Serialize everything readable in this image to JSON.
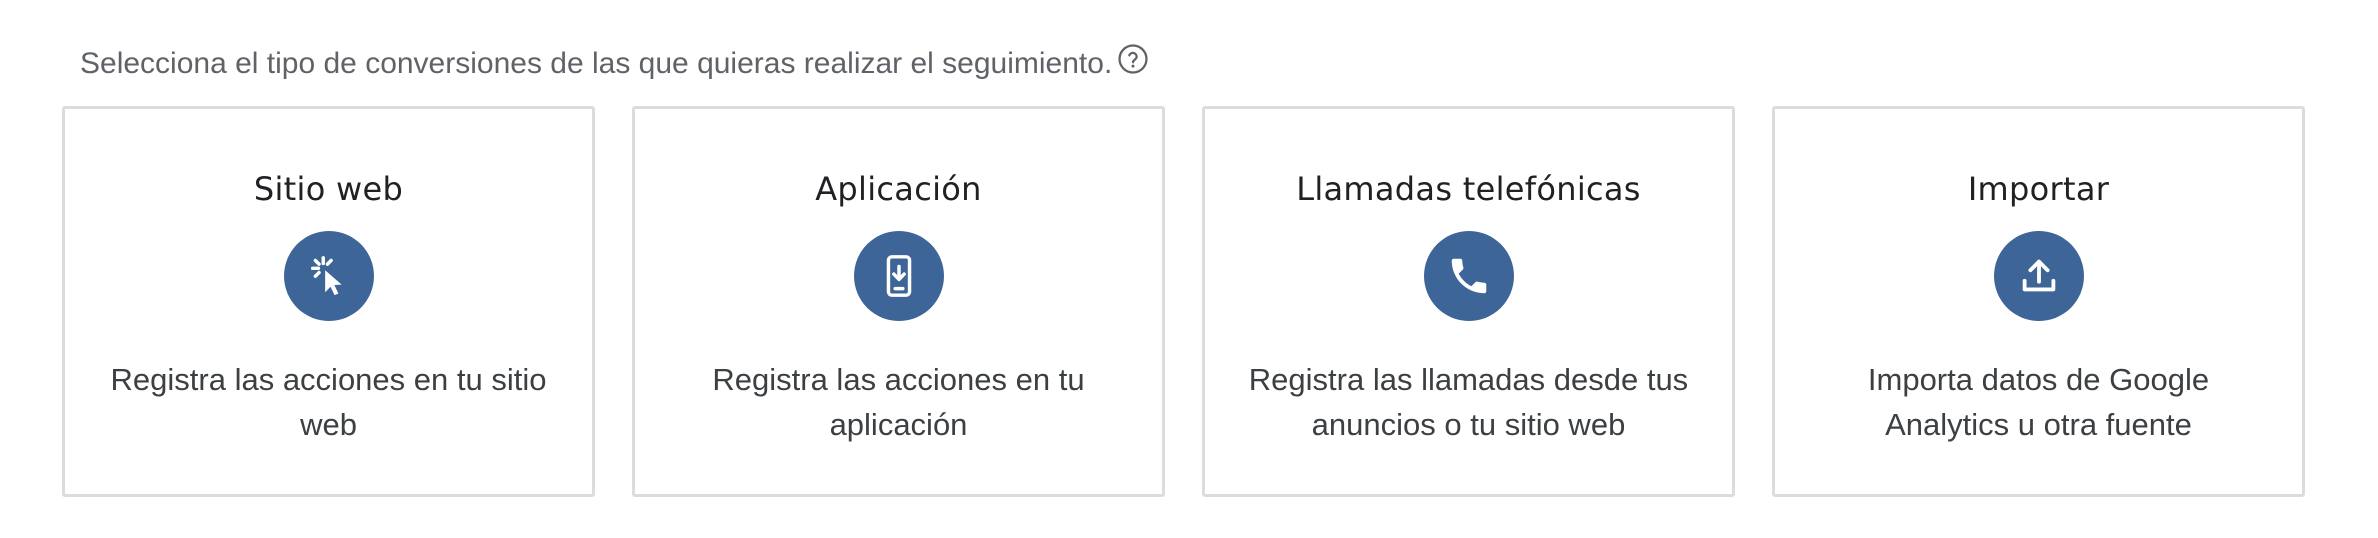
{
  "prompt": {
    "text": "Selecciona el tipo de conversiones de las que quieras realizar el seguimiento.",
    "help_icon": "help-circle-icon"
  },
  "accent_color": "#3e6597",
  "cards": [
    {
      "title": "Sitio web",
      "icon": "cursor-click-icon",
      "description": "Registra las acciones en tu sitio web"
    },
    {
      "title": "Aplicación",
      "icon": "phone-download-icon",
      "description": "Registra las acciones en tu aplicación"
    },
    {
      "title": "Llamadas telefónicas",
      "icon": "phone-call-icon",
      "description": "Registra las llamadas desde tus anuncios o tu sitio web"
    },
    {
      "title": "Importar",
      "icon": "upload-icon",
      "description": "Importa datos de Google Analytics u otra fuente"
    }
  ]
}
